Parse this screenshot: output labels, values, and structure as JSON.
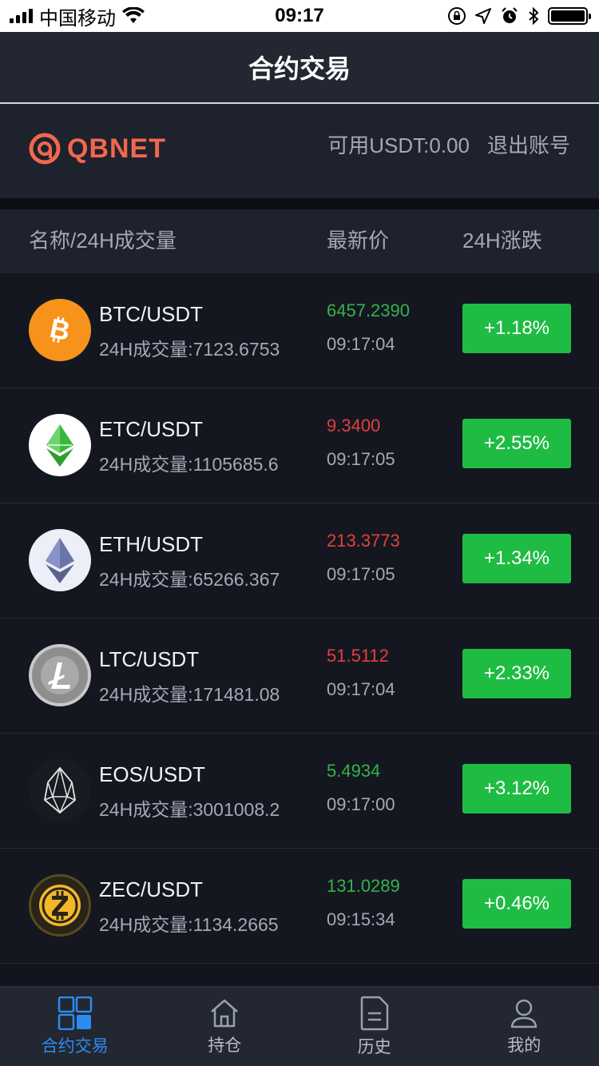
{
  "status_bar": {
    "carrier": "中国移动",
    "time": "09:17"
  },
  "header": {
    "title": "合约交易"
  },
  "account": {
    "brand": "QBNET",
    "balance": "可用USDT:0.00",
    "logout": "退出账号"
  },
  "columns": {
    "name": "名称/24H成交量",
    "price": "最新价",
    "change": "24H涨跌"
  },
  "markets": [
    {
      "pair": "BTC/USDT",
      "volume": "24H成交量:7123.6753",
      "price": "6457.2390",
      "trend": "up",
      "time": "09:17:04",
      "change": "+1.18%",
      "icon": "bitcoin-icon"
    },
    {
      "pair": "ETC/USDT",
      "volume": "24H成交量:1105685.6",
      "price": "9.3400",
      "trend": "down",
      "time": "09:17:05",
      "change": "+2.55%",
      "icon": "ethereum-classic-icon"
    },
    {
      "pair": "ETH/USDT",
      "volume": "24H成交量:65266.367",
      "price": "213.3773",
      "trend": "down",
      "time": "09:17:05",
      "change": "+1.34%",
      "icon": "ethereum-icon"
    },
    {
      "pair": "LTC/USDT",
      "volume": "24H成交量:171481.08",
      "price": "51.5112",
      "trend": "down",
      "time": "09:17:04",
      "change": "+2.33%",
      "icon": "litecoin-icon"
    },
    {
      "pair": "EOS/USDT",
      "volume": "24H成交量:3001008.2",
      "price": "5.4934",
      "trend": "up",
      "time": "09:17:00",
      "change": "+3.12%",
      "icon": "eos-icon"
    },
    {
      "pair": "ZEC/USDT",
      "volume": "24H成交量:1134.2665",
      "price": "131.0289",
      "trend": "up",
      "time": "09:15:34",
      "change": "+0.46%",
      "icon": "zcash-icon"
    }
  ],
  "tabs": [
    {
      "label": "合约交易",
      "icon": "grid-icon",
      "active": true
    },
    {
      "label": "持仓",
      "icon": "home-icon",
      "active": false
    },
    {
      "label": "历史",
      "icon": "document-icon",
      "active": false
    },
    {
      "label": "我的",
      "icon": "user-icon",
      "active": false
    }
  ],
  "colors": {
    "up": "#32b34c",
    "down": "#e0403e",
    "change_bg": "#1fbc44",
    "active_tab": "#2d8cf0",
    "brand": "#f2674e"
  }
}
